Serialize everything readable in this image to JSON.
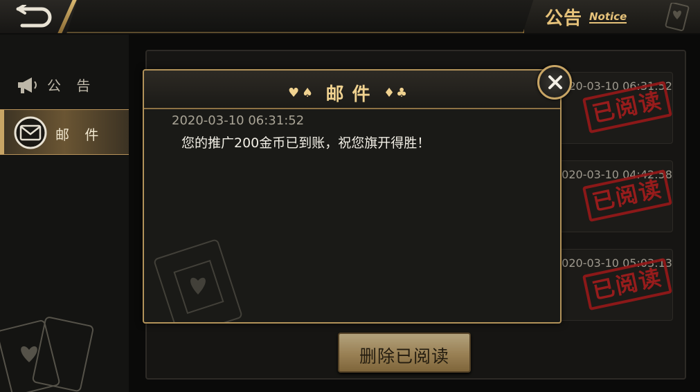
{
  "topbar": {
    "back_icon": "back-arrow-icon",
    "notice_cn": "公告",
    "notice_en": "Notice"
  },
  "sidebar": {
    "items": [
      {
        "label": "公 告",
        "icon": "megaphone-icon",
        "active": false
      },
      {
        "label": "邮 件",
        "icon": "mail-icon",
        "active": true
      }
    ]
  },
  "main": {
    "mails": [
      {
        "time": "2020-03-10 06:31:52",
        "stamp": "已阅读"
      },
      {
        "time": "2020-03-10 04:42:58",
        "stamp": "已阅读"
      },
      {
        "time": "2020-03-10 05:03:13",
        "stamp": "已阅读"
      }
    ],
    "delete_read_label": "删除已阅读"
  },
  "dialog": {
    "title": "邮件",
    "suits_left": [
      "♥",
      "♠"
    ],
    "suits_right": [
      "♦",
      "♣"
    ],
    "time": "2020-03-10 06:31:52",
    "body": "您的推广200金币已到账，祝您旗开得胜！",
    "close_icon": "close-icon"
  },
  "colors": {
    "gold": "#c8a565",
    "stamp_red": "#c21f1f",
    "background": "#141412"
  }
}
